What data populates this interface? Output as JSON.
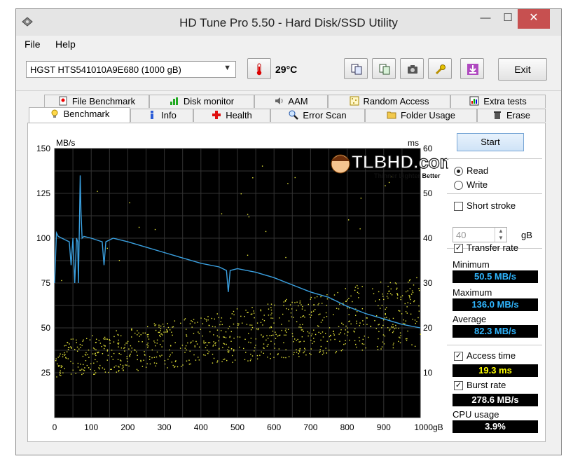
{
  "window": {
    "title": "HD Tune Pro 5.50 - Hard Disk/SSD Utility",
    "min": "—",
    "max": "☐",
    "close": "✕"
  },
  "menu": {
    "file": "File",
    "help": "Help"
  },
  "toolbar": {
    "drive": "HGST HTS541010A9E680 (1000 gB)",
    "temperature": "29°C",
    "exit_label": "Exit"
  },
  "tabs_top": [
    "File Benchmark",
    "Disk monitor",
    "AAM",
    "Random Access",
    "Extra tests"
  ],
  "tabs_bottom": [
    "Benchmark",
    "Info",
    "Health",
    "Error Scan",
    "Folder Usage",
    "Erase"
  ],
  "watermark": {
    "brand": "TLBHD.com",
    "tagline": "Thinner Lighter Better"
  },
  "controls": {
    "start_label": "Start",
    "read_label": "Read",
    "write_label": "Write",
    "short_stroke_label": "Short stroke",
    "short_stroke_value": "40",
    "short_stroke_unit": "gB",
    "transfer_rate_label": "Transfer rate",
    "minimum_label": "Minimum",
    "minimum_value": "50.5 MB/s",
    "maximum_label": "Maximum",
    "maximum_value": "136.0 MB/s",
    "average_label": "Average",
    "average_value": "82.3 MB/s",
    "access_time_label": "Access time",
    "access_time_value": "19.3 ms",
    "burst_rate_label": "Burst rate",
    "burst_rate_value": "278.6 MB/s",
    "cpu_usage_label": "CPU usage",
    "cpu_usage_value": "3.9%",
    "read_selected": true,
    "short_stroke_checked": false,
    "transfer_rate_checked": true,
    "access_time_checked": true,
    "burst_rate_checked": true
  },
  "colors": {
    "transfer_line": "#3aa0e0",
    "access_dots": "#e8e83a",
    "cyan_value": "#2fb6ff",
    "yellow_value": "#ffff00",
    "white_value": "#ffffff"
  },
  "chart_data": {
    "type": "line",
    "xlabel": "gB",
    "ylabel": "MB/s",
    "y2label": "ms",
    "xlim": [
      0,
      1000
    ],
    "ylim": [
      0,
      150
    ],
    "y2lim": [
      0,
      60
    ],
    "x_ticks": [
      "0",
      "100",
      "200",
      "300",
      "400",
      "500",
      "600",
      "700",
      "800",
      "900",
      "1000gB"
    ],
    "y_ticks": [
      "150",
      "125",
      "100",
      "75",
      "50",
      "25"
    ],
    "y2_ticks": [
      "60",
      "50",
      "40",
      "30",
      "20",
      "10"
    ],
    "series": [
      {
        "kind": "transfer",
        "x": [
          0,
          5,
          10,
          20,
          30,
          40,
          45,
          50,
          55,
          60,
          63,
          65,
          68,
          70,
          72,
          75,
          80,
          100,
          130,
          135,
          140,
          160,
          200,
          250,
          300,
          350,
          400,
          450,
          470,
          475,
          480,
          500,
          550,
          600,
          650,
          700,
          750,
          800,
          850,
          900,
          950,
          1000
        ],
        "y": [
          75,
          103,
          101,
          100,
          99,
          98,
          85,
          100,
          75,
          100,
          98,
          75,
          110,
          135,
          115,
          100,
          101,
          100,
          98,
          85,
          98,
          100,
          98,
          95,
          92,
          89,
          86,
          84,
          82,
          70,
          82,
          83,
          81,
          78,
          74,
          70,
          67,
          62,
          58,
          55,
          52,
          50
        ]
      },
      {
        "kind": "access_time_cloud",
        "description_hidden": false,
        "x_min": 0,
        "x_max": 1000,
        "y_ms_min": 6,
        "y_ms_max": 32
      }
    ]
  }
}
